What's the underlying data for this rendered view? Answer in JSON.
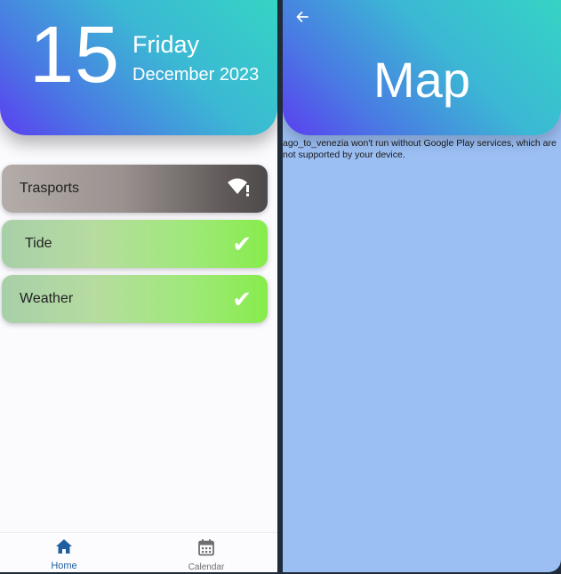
{
  "home": {
    "date": {
      "day": "15",
      "weekday": "Friday",
      "month_year": "December 2023"
    },
    "cards": [
      {
        "label": "Trasports",
        "status_icon": "wifi-alert-icon"
      },
      {
        "label": "Tide",
        "status_icon": "check-icon"
      },
      {
        "label": "Weather",
        "status_icon": "check-icon"
      }
    ],
    "check_glyph": "✔",
    "bottom_nav": {
      "home_label": "Home",
      "calendar_label": "Calendar"
    }
  },
  "map_screen": {
    "title": "Map",
    "message": "ago_to_venezia won't run without Google Play services, which are\nnot supported by your device.",
    "back_icon": "arrow-back-icon"
  },
  "colors": {
    "header_gradient_start": "#5a3ff0",
    "header_gradient_end": "#35d4c4",
    "transport_card": "#4f4b4b",
    "ok_card": "#86ec4c",
    "nav_active": "#1f5fa0",
    "map_background": "#9bbef3"
  }
}
